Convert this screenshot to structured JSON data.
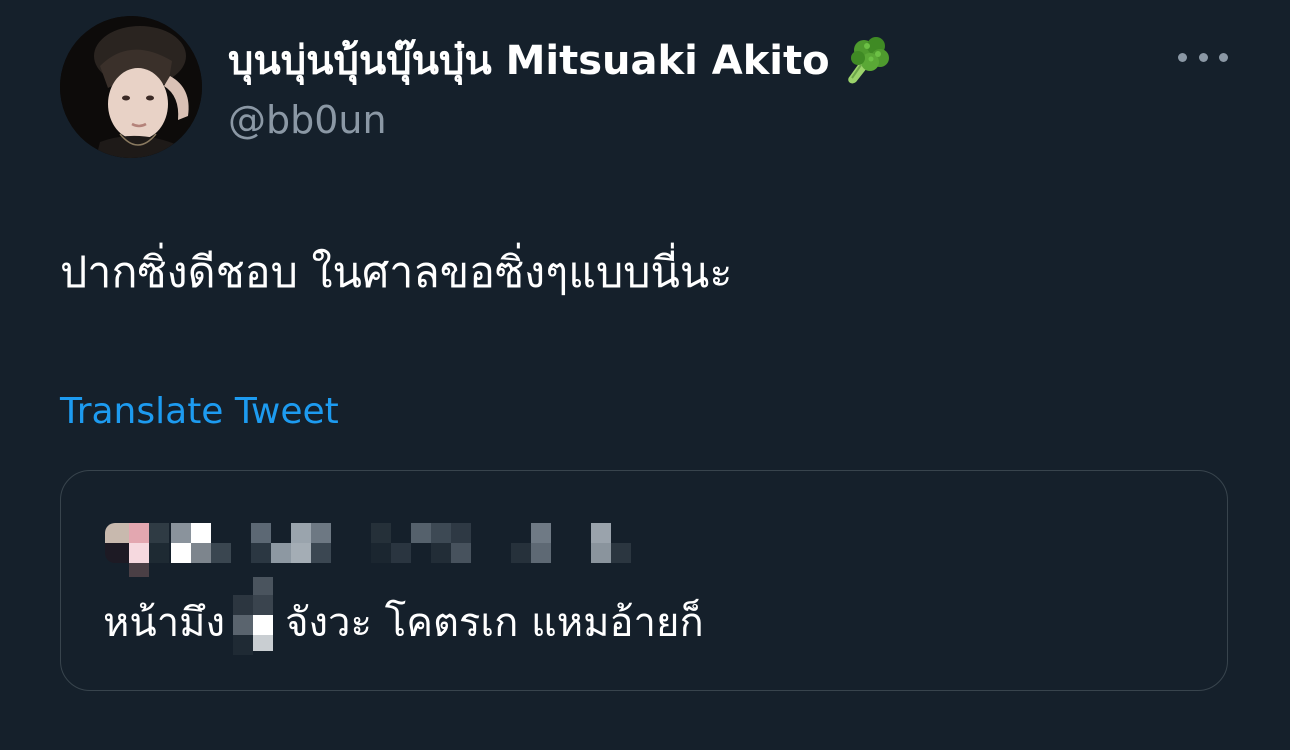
{
  "tweet": {
    "author": {
      "display_name": "บุนบุ่นบุ้นบุ๊นบุ๋น Mitsuaki Akito",
      "name_emoji": "broccoli-emoji",
      "handle": "@bb0un"
    },
    "more_icon": "more-horizontal-icon",
    "text": "ปากซิ่งดีชอบ ในศาลขอซิ่งๆแบบนี่นะ",
    "translate_label": "Translate Tweet",
    "quote": {
      "text_before": "หน้ามึง",
      "text_after": "จังวะ โคตรเก แหมอ้ายก็"
    }
  },
  "colors": {
    "background": "#15202b",
    "primary_text": "#ffffff",
    "secondary_text": "#8b98a5",
    "link": "#1d9bf0",
    "border": "#38444d"
  }
}
